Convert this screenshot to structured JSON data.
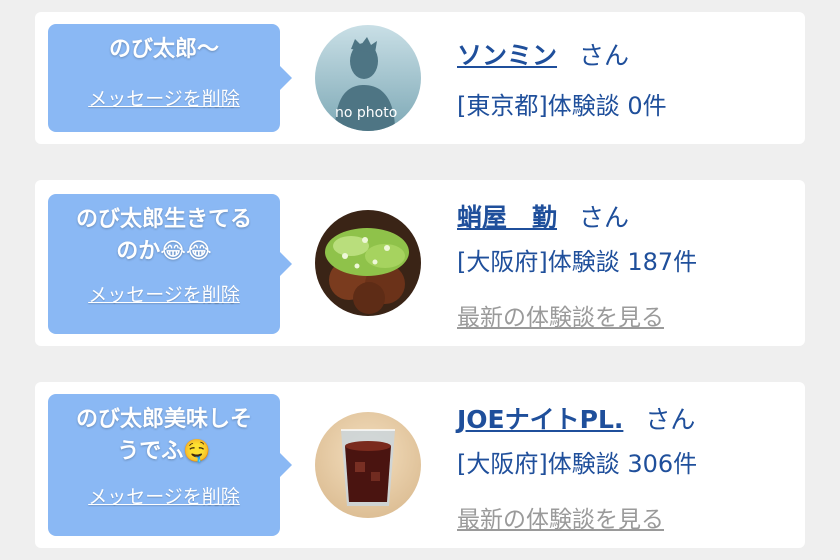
{
  "messages": [
    {
      "bubble_lines": [
        "のび太郎〜"
      ],
      "delete_label": "メッセージを削除",
      "avatar_kind": "no-photo",
      "avatar_text": "no photo",
      "name": "ソンミン",
      "honorific": "さん",
      "prefecture": "[東京都]",
      "experience_label": "体験談",
      "experience_count": "0件",
      "more_link": ""
    },
    {
      "bubble_lines": [
        "のび太郎生きてる",
        "のか😂😂"
      ],
      "delete_label": "メッセージを削除",
      "avatar_kind": "takoyaki-photo",
      "avatar_text": "",
      "name": "蛸屋　勤",
      "honorific": "さん",
      "prefecture": "[大阪府]",
      "experience_label": "体験談",
      "experience_count": "187件",
      "more_link": "最新の体験談を見る"
    },
    {
      "bubble_lines": [
        "のび太郎美味しそ",
        "うでふ🤤"
      ],
      "delete_label": "メッセージを削除",
      "avatar_kind": "drink-photo",
      "avatar_text": "",
      "name": "JOEナイトPL.",
      "honorific": "さん",
      "prefecture": "[大阪府]",
      "experience_label": "体験談",
      "experience_count": "306件",
      "more_link": "最新の体験談を見る"
    }
  ],
  "colors": {
    "background": "#efefef",
    "card": "#ffffff",
    "bubble": "#8ab8f4",
    "link_blue": "#1f4f9b",
    "muted_link": "#9a9a9a"
  }
}
